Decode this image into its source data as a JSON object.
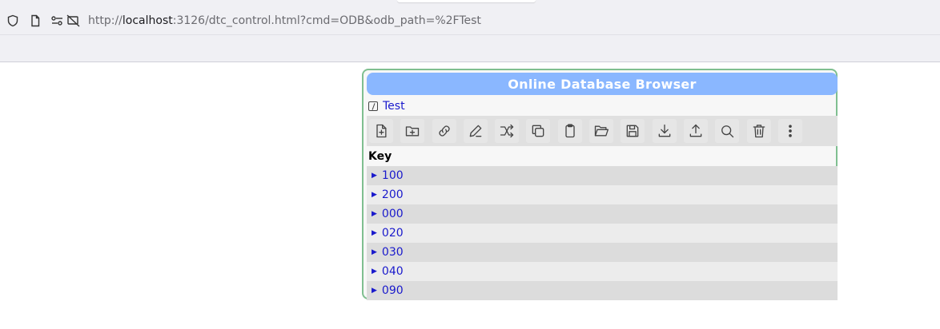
{
  "browser": {
    "url_prefix": "http://",
    "url_host": "localhost",
    "url_rest": ":3126/dtc_control.html?cmd=ODB&odb_path=%2FTest",
    "icons": [
      "shield-icon",
      "page-icon",
      "permissions-icon",
      "tracking-off-icon"
    ]
  },
  "odb": {
    "title": "Online Database Browser",
    "path_label": "Test",
    "toolbar_icons": [
      "new-key-icon",
      "new-folder-icon",
      "link-icon",
      "edit-icon",
      "shuffle-icon",
      "copy-icon",
      "clipboard-icon",
      "open-folder-icon",
      "save-icon",
      "download-icon",
      "upload-icon",
      "search-icon",
      "delete-icon",
      "more-icon"
    ],
    "key_header": "Key",
    "rows": [
      {
        "label": "100"
      },
      {
        "label": "200"
      },
      {
        "label": "000"
      },
      {
        "label": "020"
      },
      {
        "label": "030"
      },
      {
        "label": "040"
      },
      {
        "label": "090"
      }
    ]
  },
  "colors": {
    "title_bar": "#8ab7ff",
    "panel_border": "#7fbf90",
    "link": "#1a1acc"
  }
}
